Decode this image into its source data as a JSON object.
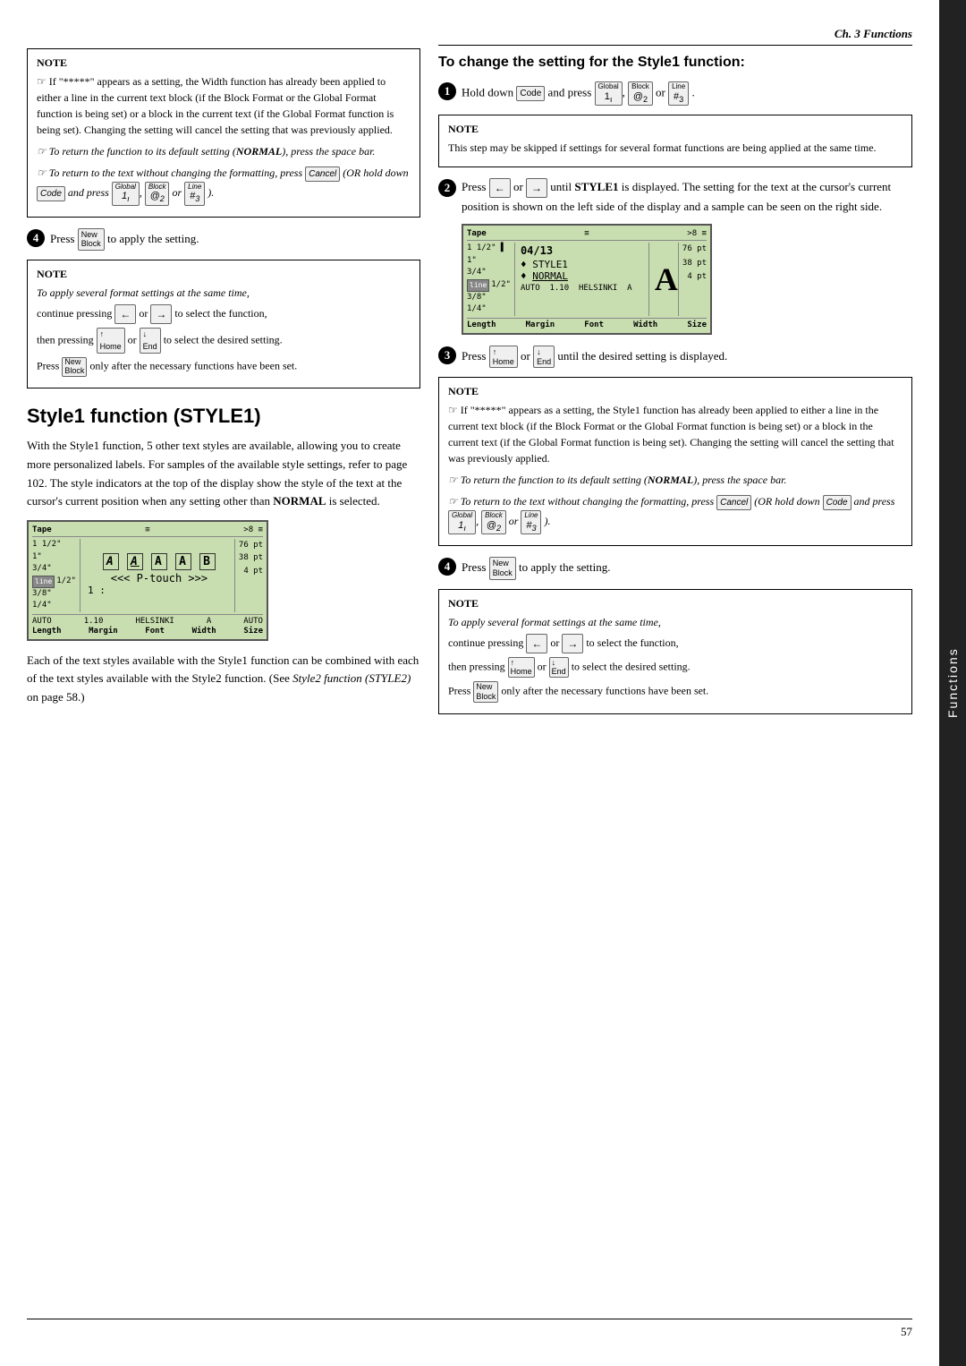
{
  "chapter": {
    "title": "Ch. 3 Functions"
  },
  "right_tab": {
    "label": "Functions"
  },
  "page_number": "57",
  "left_col": {
    "note1": {
      "title": "NOTE",
      "items": [
        "If \"*****\" appears as a setting, the Width function has already been applied to either a line in the current text block (if the Block Format or the Global Format function is being set) or a block in the current text (if the Global Format function is being set). Changing the setting will cancel the setting that was previously applied.",
        "To return the function to its default setting (NORMAL), press the space bar.",
        "To return to the text without changing the formatting, press  Cancel  (OR hold down  Code  and press  1,  @/2  or  #/3  )."
      ]
    },
    "step4_left": {
      "num": "4",
      "text": "Press",
      "key": "New/Block",
      "suffix": "to apply the setting."
    },
    "note2": {
      "title": "NOTE",
      "italic_intro": "To apply several format settings at the same time,",
      "lines": [
        "continue pressing  ←  or  →  to select the function,",
        "then pressing  ↑Home  or  ↓End  to select the desired setting.",
        "Press  New/Block  only after the necessary functions have been set."
      ]
    },
    "section": {
      "title": "Style1 function (STYLE1)",
      "body1": "With the Style1 function, 5 other text styles are available, allowing you to create more personalized labels. For samples of the available style settings, refer to page 102. The style indicators at the top of the display show the style of the text at the cursor's current position when any setting other than NORMAL is selected.",
      "body2": "Each of the text styles available with the Style1 function can be combined with each of the text styles available with the Style2 function. (See Style2 function (STYLE2) on page 58.)"
    },
    "lcd1": {
      "tape": "Tape",
      "sizes_left": [
        "1 1/2\"",
        "1\"",
        "3/4\"",
        "1/2\"",
        "3/8\"",
        "1/4\""
      ],
      "line_indicator": "line",
      "main_text": "<<< P-touch >>>",
      "sub_text": "1 :",
      "bottom": {
        "length": "Length",
        "margin": "Margin",
        "font": "Font",
        "width": "Width",
        "size": "Size"
      },
      "bottom_vals": {
        "auto": "AUTO",
        "margin": "1.10",
        "font": "HELSINKI",
        "a": "A",
        "auto2": "AUTO"
      },
      "right_bar": [
        "76 pt",
        "38 pt",
        "4 pt"
      ],
      "style_row": "A A A A A"
    }
  },
  "right_col": {
    "heading": "To change the setting for the Style1 function:",
    "step1": {
      "num": "1",
      "text": "Hold down  Code  and press  Global/1,  Block/@/2  or  Line/#/3  ."
    },
    "note1": {
      "title": "NOTE",
      "text": "This step may be skipped if settings for several format functions are being applied at the same time."
    },
    "step2": {
      "num": "2",
      "text_before": "Press",
      "key1": "←",
      "or": "or",
      "key2": "→",
      "text_after": "until STYLE1 is displayed.",
      "desc": "The setting for the text at the cursor's current position is shown on the left side of the display and a sample can be seen on the right side."
    },
    "lcd2": {
      "tape": "Tape",
      "sizes_left": [
        "1 1/2\"",
        "1\"",
        "3/4\"",
        "1/2\"",
        "3/8\"",
        "1/4\""
      ],
      "line_indicator": "line",
      "date": "04/13",
      "style_line": "♦ STYLE1",
      "normal_line": "♦ NORMAL",
      "right_big": "A",
      "bottom": {
        "length": "Length",
        "margin": "Margin",
        "font": "Font",
        "width": "Width",
        "size": "Size"
      },
      "bottom_vals": {
        "auto": "AUTO",
        "margin": "1.10",
        "font": "HELSINKI",
        "a": "A",
        "auto2": "AUTO"
      },
      "right_bar": [
        "76 pt",
        "38 pt",
        "4 pt"
      ]
    },
    "step3": {
      "num": "3",
      "text_before": "Press",
      "key1": "↑Home",
      "or": "or",
      "key2": "↓End",
      "text_after": "until the desired setting is displayed."
    },
    "note2": {
      "title": "NOTE",
      "items": [
        "If \"*****\" appears as a setting, the Style1 function has already been applied to either a line in the current text block (if the Block Format or the Global Format function is being set) or a block in the current text (if the Global Format function is being set). Changing the setting will cancel the setting that was previously applied.",
        "To return the function to its default setting (NORMAL), press the space bar.",
        "To return to the text without changing the formatting, press  Cancel  (OR hold down  Code  and press  1,  @/2  or  #/3  )."
      ]
    },
    "step4": {
      "num": "4",
      "text": "Press",
      "key": "New/Block",
      "suffix": "to apply the setting."
    },
    "note3": {
      "title": "NOTE",
      "italic_intro": "To apply several format settings at the same time,",
      "lines": [
        "continue pressing  ←  or  →  to select the function,",
        "then pressing  ↑Home  or  ↓End  to select the desired setting.",
        "Press  New/Block  only after the necessary functions have been set."
      ]
    }
  }
}
